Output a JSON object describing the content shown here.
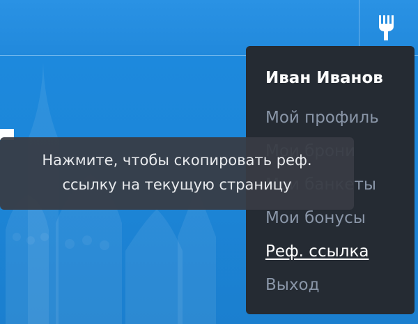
{
  "header": {
    "logo_icon": "fork-icon"
  },
  "user_menu": {
    "user_name": "Иван Иванов",
    "items": [
      {
        "label": "Мой профиль"
      },
      {
        "label": "Мои брони"
      },
      {
        "label": "Мои банкеты"
      },
      {
        "label": "Мои бонусы"
      },
      {
        "label": "Реф. ссылка",
        "active": true
      },
      {
        "label": "Выход"
      }
    ]
  },
  "tooltip": {
    "line1": "Нажмите, чтобы скопировать реф.",
    "line2": "ссылку на текущую страницу"
  },
  "colors": {
    "background_blue": "#1e8be0",
    "dropdown_bg": "#252b33",
    "menu_item_text": "#8a96a8",
    "tooltip_bg": "#383c44"
  }
}
